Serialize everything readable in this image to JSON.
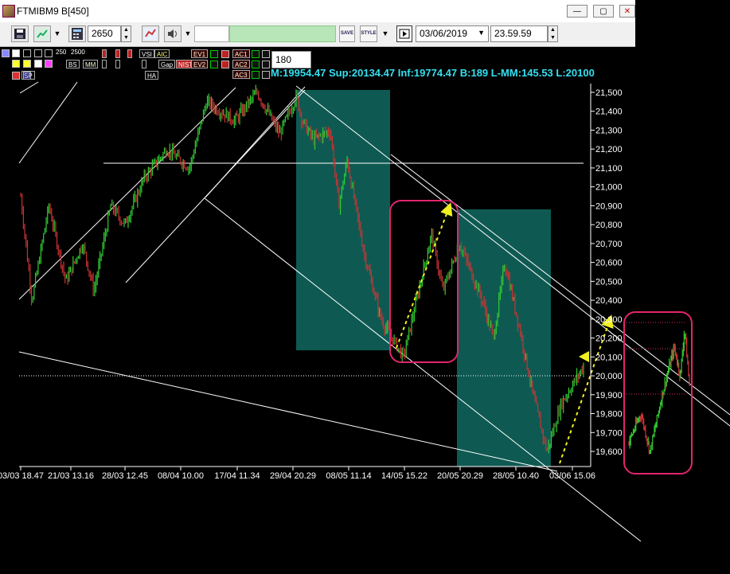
{
  "window": {
    "title": "FTMIBM9 B[450]",
    "minimize": "—",
    "maximize": "▢",
    "close": "✕"
  },
  "toolbar": {
    "bars_value": "2650",
    "date_value": "03/06/2019",
    "time_value": "23.59.59",
    "save_label": "SAVE",
    "style_label": "STYLE"
  },
  "panel": {
    "bar_counts": [
      "250",
      "2500"
    ],
    "buttons": [
      "BS",
      "MM",
      "VSI",
      "AIC",
      "Gap",
      "NIST",
      "EV1",
      "EV2",
      "AC1",
      "AC2",
      "AC3",
      "HA",
      "SP"
    ],
    "value_box": "180"
  },
  "info": {
    "text": "M:19954.47 Sup:20134.47 Inf:19774.47 B:189 L-MM:145.53 L:20100"
  },
  "colors": {
    "up": "#33cc33",
    "down": "#cc3333",
    "zone": "#0e5a52",
    "highlight": "#e0256b",
    "arrow": "#f0f020",
    "info": "#33e0f0"
  },
  "chart_data": {
    "type": "candlestick",
    "symbol": "FTMIBM9",
    "y_ticks": [
      19600,
      19700,
      19800,
      19900,
      20000,
      20100,
      20200,
      20300,
      20400,
      20500,
      20600,
      20700,
      20800,
      20900,
      21000,
      21100,
      21200,
      21300,
      21400,
      21500
    ],
    "y_tick_labels": [
      "19,600",
      "19,700",
      "19,800",
      "19,900",
      "20,000",
      "20,100",
      "20,200",
      "20,300",
      "20,400",
      "20,500",
      "20,600",
      "20,700",
      "20,800",
      "20,900",
      "21,000",
      "21,100",
      "21,200",
      "21,300",
      "21,400",
      "21,500"
    ],
    "ylim": [
      19530,
      21540
    ],
    "x_tick_labels": [
      "03/03 18.47",
      "21/03 13.16",
      "28/03 12.45",
      "08/04 10.00",
      "17/04 11.34",
      "29/04 20.29",
      "08/05 11.14",
      "14/05 15.22",
      "20/05 20.29",
      "28/05 10.40",
      "03/06 15.06"
    ],
    "price_path": [
      [
        0.0,
        20950
      ],
      [
        0.02,
        20400
      ],
      [
        0.05,
        20900
      ],
      [
        0.08,
        20500
      ],
      [
        0.11,
        20700
      ],
      [
        0.13,
        20450
      ],
      [
        0.16,
        20900
      ],
      [
        0.185,
        20800
      ],
      [
        0.22,
        21050
      ],
      [
        0.26,
        21200
      ],
      [
        0.3,
        21100
      ],
      [
        0.33,
        21450
      ],
      [
        0.38,
        21350
      ],
      [
        0.42,
        21500
      ],
      [
        0.46,
        21280
      ],
      [
        0.49,
        21480
      ],
      [
        0.5,
        21350
      ],
      [
        0.52,
        21250
      ],
      [
        0.55,
        21300
      ],
      [
        0.565,
        20900
      ],
      [
        0.58,
        21140
      ],
      [
        0.61,
        20650
      ],
      [
        0.64,
        20300
      ],
      [
        0.68,
        20100
      ],
      [
        0.73,
        20750
      ],
      [
        0.75,
        20450
      ],
      [
        0.78,
        20700
      ],
      [
        0.82,
        20400
      ],
      [
        0.84,
        20200
      ],
      [
        0.86,
        20600
      ],
      [
        0.89,
        20200
      ],
      [
        0.91,
        19900
      ],
      [
        0.935,
        19600
      ],
      [
        0.96,
        19850
      ],
      [
        1.0,
        20050
      ]
    ],
    "inset_path": [
      [
        0.0,
        19650
      ],
      [
        0.2,
        19800
      ],
      [
        0.35,
        19600
      ],
      [
        0.55,
        19900
      ],
      [
        0.75,
        20150
      ],
      [
        0.85,
        20000
      ],
      [
        0.92,
        20250
      ],
      [
        1.0,
        19950
      ]
    ],
    "levels": {
      "resistance": 21125,
      "mean": 19954.47,
      "sup": 20134.47,
      "inf": 19774.47,
      "l": 20100
    }
  }
}
